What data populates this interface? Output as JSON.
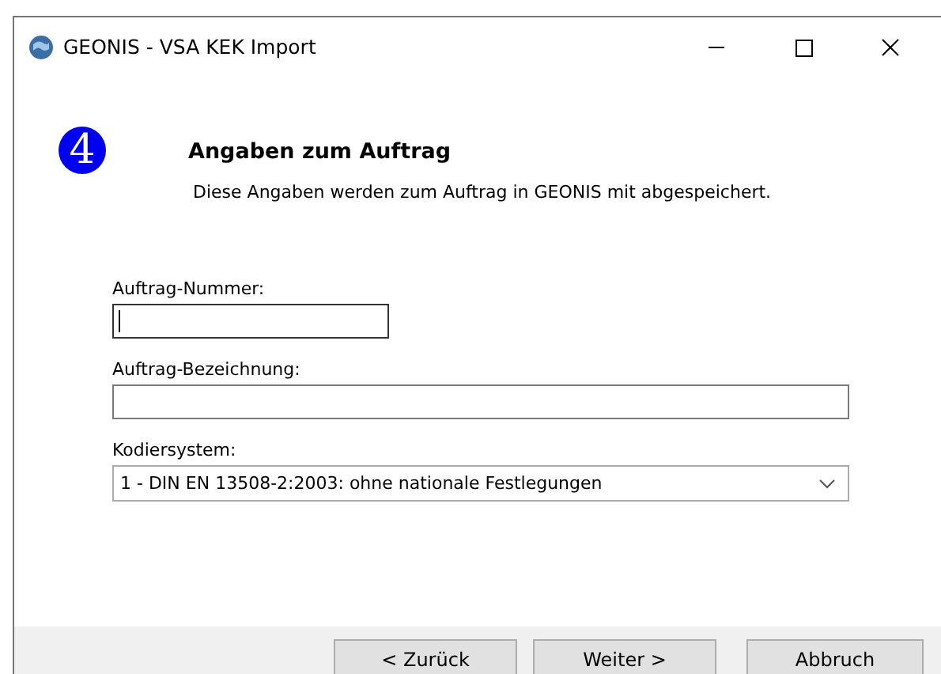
{
  "window": {
    "title": "GEONIS - VSA KEK Import"
  },
  "header": {
    "step": "4",
    "title": "Angaben zum Auftrag",
    "subtitle": "Diese Angaben werden zum Auftrag in GEONIS mit abgespeichert."
  },
  "fields": [
    {
      "kind": "text",
      "label": "Auftrag-Nummer:",
      "focused": true,
      "wide": false
    },
    {
      "kind": "text",
      "label": "Auftrag-Bezeichnung:",
      "focused": false,
      "wide": true
    },
    {
      "kind": "select",
      "label": "Kodiersystem:",
      "value": "1 - DIN EN 13508-2:2003: ohne nationale Festlegungen",
      "focused": false,
      "wide": true
    }
  ],
  "buttons": [
    "< Zurück",
    "Weiter >",
    "Abbruch"
  ]
}
